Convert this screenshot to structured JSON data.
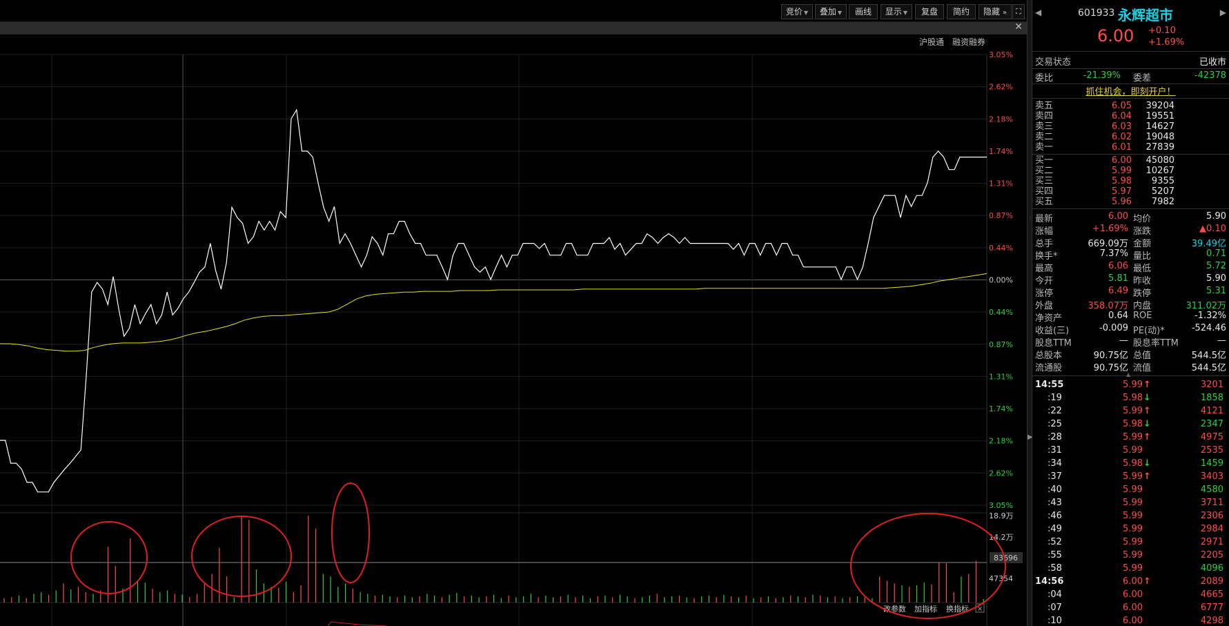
{
  "toolbar": {
    "buttons": [
      {
        "label": "竞价",
        "dropdown": true
      },
      {
        "label": "叠加",
        "dropdown": true
      },
      {
        "label": "画线",
        "dropdown": false
      },
      {
        "label": "显示",
        "dropdown": true
      },
      {
        "label": "复盘",
        "dropdown": false
      },
      {
        "label": "简约",
        "dropdown": false
      },
      {
        "label": "隐藏",
        "dropdown": false
      }
    ],
    "expand_icon": "double-chevron-right-icon",
    "fullscreen_icon": "fullscreen-icon",
    "close_icon": "close-icon"
  },
  "chart_tags": {
    "hgt": "沪股通",
    "margin": "融资融券"
  },
  "chart_data": {
    "type": "line",
    "y_axis_labels": [
      "3.05%",
      "2.62%",
      "2.18%",
      "1.74%",
      "1.31%",
      "0.87%",
      "0.44%",
      "0.00%",
      "0.44%",
      "0.87%",
      "1.31%",
      "1.74%",
      "2.18%",
      "2.62%",
      "3.05%"
    ],
    "ylim_pct": [
      -3.05,
      3.05
    ],
    "series": [
      {
        "color": "#ffffff",
        "values": [
          -2.18,
          -2.18,
          -2.49,
          -2.49,
          -2.57,
          -2.75,
          -2.75,
          -2.88,
          -2.88,
          -2.88,
          -2.75,
          -2.66,
          -2.57,
          -2.49,
          -2.4,
          -2.31,
          -1.31,
          -0.17,
          -0.04,
          -0.13,
          -0.34,
          0.04,
          -0.39,
          -0.77,
          -0.66,
          -0.34,
          -0.6,
          -0.46,
          -0.34,
          -0.6,
          -0.48,
          -0.17,
          -0.48,
          -0.39,
          -0.26,
          -0.17,
          -0.04,
          0.1,
          0.17,
          0.49,
          0.12,
          -0.13,
          0.23,
          0.98,
          0.84,
          0.76,
          0.49,
          0.58,
          0.79,
          0.67,
          0.79,
          0.67,
          0.92,
          0.84,
          2.18,
          2.3,
          1.74,
          1.74,
          1.66,
          1.31,
          0.98,
          0.79,
          0.99,
          0.49,
          0.62,
          0.49,
          0.33,
          0.17,
          0.33,
          0.58,
          0.49,
          0.33,
          0.62,
          0.62,
          0.79,
          0.79,
          0.62,
          0.49,
          0.49,
          0.33,
          0.33,
          0.33,
          0.17,
          0.0,
          0.33,
          0.49,
          0.49,
          0.33,
          0.17,
          0.1,
          0.17,
          0.0,
          0.17,
          0.33,
          0.17,
          0.33,
          0.33,
          0.49,
          0.49,
          0.49,
          0.42,
          0.49,
          0.33,
          0.33,
          0.33,
          0.49,
          0.49,
          0.33,
          0.33,
          0.33,
          0.49,
          0.49,
          0.49,
          0.57,
          0.41,
          0.49,
          0.33,
          0.41,
          0.49,
          0.49,
          0.62,
          0.57,
          0.49,
          0.57,
          0.62,
          0.57,
          0.49,
          0.57,
          0.49,
          0.49,
          0.49,
          0.49,
          0.49,
          0.49,
          0.49,
          0.49,
          0.41,
          0.49,
          0.33,
          0.49,
          0.49,
          0.33,
          0.49,
          0.49,
          0.33,
          0.49,
          0.49,
          0.33,
          0.33,
          0.17,
          0.17,
          0.17,
          0.17,
          0.17,
          0.17,
          0.17,
          0.0,
          0.17,
          0.17,
          0.0,
          0.17,
          0.49,
          0.84,
          0.99,
          1.14,
          1.14,
          1.14,
          0.84,
          1.14,
          0.99,
          1.14,
          1.14,
          1.31,
          1.66,
          1.74,
          1.66,
          1.49,
          1.49,
          1.66,
          1.66,
          1.66,
          1.66,
          1.66,
          1.66
        ]
      },
      {
        "color": "#e6e619",
        "values": [
          -0.87,
          -0.87,
          -0.88,
          -0.9,
          -0.93,
          -0.95,
          -0.96,
          -0.97,
          -0.97,
          -0.96,
          -0.92,
          -0.89,
          -0.87,
          -0.86,
          -0.86,
          -0.86,
          -0.85,
          -0.84,
          -0.82,
          -0.79,
          -0.75,
          -0.72,
          -0.7,
          -0.67,
          -0.64,
          -0.6,
          -0.55,
          -0.52,
          -0.5,
          -0.49,
          -0.49,
          -0.48,
          -0.47,
          -0.46,
          -0.45,
          -0.44,
          -0.4,
          -0.33,
          -0.26,
          -0.22,
          -0.2,
          -0.19,
          -0.18,
          -0.17,
          -0.17,
          -0.16,
          -0.16,
          -0.16,
          -0.16,
          -0.15,
          -0.15,
          -0.15,
          -0.15,
          -0.14,
          -0.14,
          -0.14,
          -0.14,
          -0.14,
          -0.14,
          -0.14,
          -0.14,
          -0.14,
          -0.13,
          -0.13,
          -0.13,
          -0.13,
          -0.13,
          -0.13,
          -0.13,
          -0.13,
          -0.13,
          -0.13,
          -0.13,
          -0.13,
          -0.13,
          -0.12,
          -0.12,
          -0.12,
          -0.12,
          -0.12,
          -0.12,
          -0.12,
          -0.12,
          -0.12,
          -0.12,
          -0.12,
          -0.12,
          -0.12,
          -0.12,
          -0.12,
          -0.12,
          -0.12,
          -0.12,
          -0.12,
          -0.12,
          -0.11,
          -0.1,
          -0.09,
          -0.07,
          -0.05,
          -0.02,
          0.0,
          0.02,
          0.04,
          0.06,
          0.08
        ]
      }
    ],
    "volume_axis_labels": [
      "18.9万",
      "14.2万",
      "83696",
      "47354"
    ],
    "volume": [
      {
        "v": 0.05,
        "up": true
      },
      {
        "v": 0.06,
        "up": true
      },
      {
        "v": 0.08,
        "up": false
      },
      {
        "v": 0.05,
        "up": true
      },
      {
        "v": 0.1,
        "up": false
      },
      {
        "v": 0.12,
        "up": false
      },
      {
        "v": 0.09,
        "up": true
      },
      {
        "v": 0.14,
        "up": false
      },
      {
        "v": 0.22,
        "up": true
      },
      {
        "v": 0.15,
        "up": false
      },
      {
        "v": 0.18,
        "up": true
      },
      {
        "v": 0.12,
        "up": true
      },
      {
        "v": 0.1,
        "up": false
      },
      {
        "v": 0.14,
        "up": true
      },
      {
        "v": 0.64,
        "up": true
      },
      {
        "v": 0.42,
        "up": true
      },
      {
        "v": 0.16,
        "up": false
      },
      {
        "v": 0.74,
        "up": true
      },
      {
        "v": 0.25,
        "up": false
      },
      {
        "v": 0.23,
        "up": false
      },
      {
        "v": 0.16,
        "up": true
      },
      {
        "v": 0.12,
        "up": false
      },
      {
        "v": 0.14,
        "up": false
      },
      {
        "v": 0.1,
        "up": true
      },
      {
        "v": 0.09,
        "up": false
      },
      {
        "v": 0.06,
        "up": true
      },
      {
        "v": 0.1,
        "up": true
      },
      {
        "v": 0.22,
        "up": true
      },
      {
        "v": 0.33,
        "up": true
      },
      {
        "v": 0.63,
        "up": true
      },
      {
        "v": 0.3,
        "up": true
      },
      {
        "v": 0.06,
        "up": false
      },
      {
        "v": 1.0,
        "up": true
      },
      {
        "v": 0.95,
        "up": true
      },
      {
        "v": 0.38,
        "up": false
      },
      {
        "v": 0.22,
        "up": false
      },
      {
        "v": 0.18,
        "up": false
      },
      {
        "v": 0.17,
        "up": true
      },
      {
        "v": 0.24,
        "up": false
      },
      {
        "v": 0.12,
        "up": true
      },
      {
        "v": 0.2,
        "up": true
      },
      {
        "v": 1.0,
        "up": true
      },
      {
        "v": 0.85,
        "up": true
      },
      {
        "v": 0.33,
        "up": false
      },
      {
        "v": 0.3,
        "up": false
      },
      {
        "v": 0.18,
        "up": false
      },
      {
        "v": 0.22,
        "up": false
      },
      {
        "v": 0.16,
        "up": true
      },
      {
        "v": 0.12,
        "up": false
      },
      {
        "v": 0.1,
        "up": false
      },
      {
        "v": 0.08,
        "up": true
      },
      {
        "v": 0.09,
        "up": false
      },
      {
        "v": 0.07,
        "up": false
      },
      {
        "v": 0.06,
        "up": true
      },
      {
        "v": 0.08,
        "up": false
      },
      {
        "v": 0.06,
        "up": false
      },
      {
        "v": 0.07,
        "up": true
      },
      {
        "v": 0.1,
        "up": false
      },
      {
        "v": 0.08,
        "up": false
      },
      {
        "v": 0.06,
        "up": true
      },
      {
        "v": 0.09,
        "up": false
      },
      {
        "v": 0.11,
        "up": false
      },
      {
        "v": 0.07,
        "up": true
      },
      {
        "v": 0.08,
        "up": false
      },
      {
        "v": 0.06,
        "up": false
      },
      {
        "v": 0.07,
        "up": true
      },
      {
        "v": 0.09,
        "up": false
      },
      {
        "v": 0.05,
        "up": false
      },
      {
        "v": 0.08,
        "up": true
      },
      {
        "v": 0.06,
        "up": false
      },
      {
        "v": 0.07,
        "up": false
      },
      {
        "v": 0.1,
        "up": false
      },
      {
        "v": 0.06,
        "up": true
      },
      {
        "v": 0.08,
        "up": false
      },
      {
        "v": 0.06,
        "up": false
      },
      {
        "v": 0.07,
        "up": true
      },
      {
        "v": 0.09,
        "up": false
      },
      {
        "v": 0.06,
        "up": true
      },
      {
        "v": 0.08,
        "up": false
      },
      {
        "v": 0.05,
        "up": false
      },
      {
        "v": 0.07,
        "up": true
      },
      {
        "v": 0.08,
        "up": false
      },
      {
        "v": 0.06,
        "up": true
      },
      {
        "v": 0.09,
        "up": false
      },
      {
        "v": 0.07,
        "up": false
      },
      {
        "v": 0.05,
        "up": true
      },
      {
        "v": 0.06,
        "up": false
      },
      {
        "v": 0.08,
        "up": false
      },
      {
        "v": 0.1,
        "up": true
      },
      {
        "v": 0.06,
        "up": false
      },
      {
        "v": 0.07,
        "up": false
      },
      {
        "v": 0.08,
        "up": true
      },
      {
        "v": 0.06,
        "up": false
      },
      {
        "v": 0.05,
        "up": true
      },
      {
        "v": 0.07,
        "up": false
      },
      {
        "v": 0.08,
        "up": false
      },
      {
        "v": 0.06,
        "up": true
      },
      {
        "v": 0.09,
        "up": false
      },
      {
        "v": 0.07,
        "up": true
      },
      {
        "v": 0.06,
        "up": false
      },
      {
        "v": 0.08,
        "up": true
      },
      {
        "v": 0.05,
        "up": false
      },
      {
        "v": 0.06,
        "up": true
      },
      {
        "v": 0.07,
        "up": false
      },
      {
        "v": 0.05,
        "up": true
      },
      {
        "v": 0.06,
        "up": false
      },
      {
        "v": 0.08,
        "up": true
      },
      {
        "v": 0.07,
        "up": false
      },
      {
        "v": 0.06,
        "up": true
      },
      {
        "v": 0.09,
        "up": false
      },
      {
        "v": 0.08,
        "up": true
      },
      {
        "v": 0.06,
        "up": false
      },
      {
        "v": 0.07,
        "up": true
      },
      {
        "v": 0.05,
        "up": false
      },
      {
        "v": 0.06,
        "up": true
      },
      {
        "v": 0.07,
        "up": false
      },
      {
        "v": 0.06,
        "up": true
      },
      {
        "v": 0.05,
        "up": false
      },
      {
        "v": 0.3,
        "up": true
      },
      {
        "v": 0.25,
        "up": true
      },
      {
        "v": 0.22,
        "up": true
      },
      {
        "v": 0.2,
        "up": false
      },
      {
        "v": 0.18,
        "up": true
      },
      {
        "v": 0.2,
        "up": false
      },
      {
        "v": 0.23,
        "up": false
      },
      {
        "v": 0.21,
        "up": true
      },
      {
        "v": 0.46,
        "up": true
      },
      {
        "v": 0.45,
        "up": true
      },
      {
        "v": 0.12,
        "up": true
      },
      {
        "v": 0.3,
        "up": false
      },
      {
        "v": 0.33,
        "up": true
      },
      {
        "v": 0.48,
        "up": true
      },
      {
        "v": 0.04,
        "up": false
      }
    ],
    "volume_tools": [
      "改参数",
      "加指标",
      "换指标"
    ],
    "annotation_color": "#e02020"
  },
  "quote": {
    "code": "601933",
    "name": "永辉超市",
    "price": "6.00",
    "change": "+0.10",
    "change_pct": "+1.69%",
    "status_label": "交易状态",
    "status_value": "已收市",
    "weibi_label": "委比",
    "weibi_value": "-21.39%",
    "weicha_label": "委差",
    "weicha_value": "-42378",
    "promo": "抓住机会，即刻开户！",
    "asks": [
      {
        "label": "卖五",
        "price": "6.05",
        "vol": "39204"
      },
      {
        "label": "卖四",
        "price": "6.04",
        "vol": "19551"
      },
      {
        "label": "卖三",
        "price": "6.03",
        "vol": "14627"
      },
      {
        "label": "卖二",
        "price": "6.02",
        "vol": "19048"
      },
      {
        "label": "卖一",
        "price": "6.01",
        "vol": "27839"
      }
    ],
    "bids": [
      {
        "label": "买一",
        "price": "6.00",
        "vol": "45080"
      },
      {
        "label": "买二",
        "price": "5.99",
        "vol": "10267"
      },
      {
        "label": "买三",
        "price": "5.98",
        "vol": "9355"
      },
      {
        "label": "买四",
        "price": "5.97",
        "vol": "5207"
      },
      {
        "label": "买五",
        "price": "5.96",
        "vol": "7982"
      }
    ],
    "stats": [
      {
        "l1": "最新",
        "v1": "6.00",
        "c1": "red",
        "l2": "均价",
        "v2": "5.90",
        "c2": "white"
      },
      {
        "l1": "涨幅",
        "v1": "+1.69%",
        "c1": "red",
        "l2": "涨跌",
        "v2": "▲0.10",
        "c2": "red"
      },
      {
        "l1": "总手",
        "v1": "669.09万",
        "c1": "white",
        "l2": "金额",
        "v2": "39.49亿",
        "c2": "cyan"
      },
      {
        "l1": "换手*",
        "v1": "7.37%",
        "c1": "white",
        "l2": "量比",
        "v2": "0.71",
        "c2": "green"
      },
      {
        "l1": "最高",
        "v1": "6.06",
        "c1": "red",
        "l2": "最低",
        "v2": "5.72",
        "c2": "green"
      },
      {
        "l1": "今开",
        "v1": "5.81",
        "c1": "green",
        "l2": "昨收",
        "v2": "5.90",
        "c2": "white"
      },
      {
        "l1": "涨停",
        "v1": "6.49",
        "c1": "red",
        "l2": "跌停",
        "v2": "5.31",
        "c2": "green"
      },
      {
        "l1": "外盘",
        "v1": "358.07万",
        "c1": "red",
        "l2": "内盘",
        "v2": "311.02万",
        "c2": "green"
      },
      {
        "l1": "净资产",
        "v1": "0.64",
        "c1": "white",
        "l2": "ROE",
        "v2": "-1.32%",
        "c2": "white"
      },
      {
        "l1": "收益(三)",
        "v1": "-0.009",
        "c1": "white",
        "l2": "PE(动)*",
        "v2": "-524.46",
        "c2": "white"
      },
      {
        "l1": "股息TTM",
        "v1": "—",
        "c1": "white",
        "l2": "股息率TTM",
        "v2": "—",
        "c2": "white"
      },
      {
        "l1": "总股本",
        "v1": "90.75亿",
        "c1": "white",
        "l2": "总值",
        "v2": "544.5亿",
        "c2": "white"
      },
      {
        "l1": "流通股",
        "v1": "90.75亿",
        "c1": "white",
        "l2": "流值",
        "v2": "544.5亿",
        "c2": "white"
      }
    ],
    "ticks": [
      {
        "t": "14:55",
        "p": "5.99",
        "pc": "red",
        "arrow": "↑",
        "ac": "red",
        "v": "3201",
        "vc": "red",
        "bold": true
      },
      {
        "t": ":19",
        "p": "5.98",
        "pc": "red",
        "arrow": "↓",
        "ac": "green",
        "v": "1858",
        "vc": "green"
      },
      {
        "t": ":22",
        "p": "5.99",
        "pc": "red",
        "arrow": "↑",
        "ac": "red",
        "v": "4121",
        "vc": "red"
      },
      {
        "t": ":25",
        "p": "5.98",
        "pc": "red",
        "arrow": "↓",
        "ac": "green",
        "v": "2347",
        "vc": "green"
      },
      {
        "t": ":28",
        "p": "5.99",
        "pc": "red",
        "arrow": "↑",
        "ac": "red",
        "v": "4975",
        "vc": "red"
      },
      {
        "t": ":31",
        "p": "5.99",
        "pc": "red",
        "arrow": "",
        "ac": "red",
        "v": "2535",
        "vc": "red"
      },
      {
        "t": ":34",
        "p": "5.98",
        "pc": "red",
        "arrow": "↓",
        "ac": "green",
        "v": "1459",
        "vc": "green"
      },
      {
        "t": ":37",
        "p": "5.99",
        "pc": "red",
        "arrow": "↑",
        "ac": "red",
        "v": "3403",
        "vc": "red"
      },
      {
        "t": ":40",
        "p": "5.99",
        "pc": "red",
        "arrow": "",
        "ac": "red",
        "v": "4580",
        "vc": "green"
      },
      {
        "t": ":43",
        "p": "5.99",
        "pc": "red",
        "arrow": "",
        "ac": "red",
        "v": "3711",
        "vc": "red"
      },
      {
        "t": ":46",
        "p": "5.99",
        "pc": "red",
        "arrow": "",
        "ac": "red",
        "v": "2306",
        "vc": "red"
      },
      {
        "t": ":49",
        "p": "5.99",
        "pc": "red",
        "arrow": "",
        "ac": "red",
        "v": "2984",
        "vc": "red"
      },
      {
        "t": ":52",
        "p": "5.99",
        "pc": "red",
        "arrow": "",
        "ac": "red",
        "v": "2971",
        "vc": "red"
      },
      {
        "t": ":55",
        "p": "5.99",
        "pc": "red",
        "arrow": "",
        "ac": "red",
        "v": "2205",
        "vc": "red"
      },
      {
        "t": ":58",
        "p": "5.99",
        "pc": "red",
        "arrow": "",
        "ac": "red",
        "v": "4096",
        "vc": "green"
      },
      {
        "t": "14:56",
        "p": "6.00",
        "pc": "red",
        "arrow": "↑",
        "ac": "red",
        "v": "2089",
        "vc": "red",
        "bold": true
      },
      {
        "t": ":04",
        "p": "6.00",
        "pc": "red",
        "arrow": "",
        "ac": "red",
        "v": "4665",
        "vc": "red"
      },
      {
        "t": ":07",
        "p": "6.00",
        "pc": "red",
        "arrow": "",
        "ac": "red",
        "v": "6777",
        "vc": "red"
      },
      {
        "t": ":10",
        "p": "6.00",
        "pc": "red",
        "arrow": "",
        "ac": "red",
        "v": "4298",
        "vc": "red"
      }
    ]
  }
}
